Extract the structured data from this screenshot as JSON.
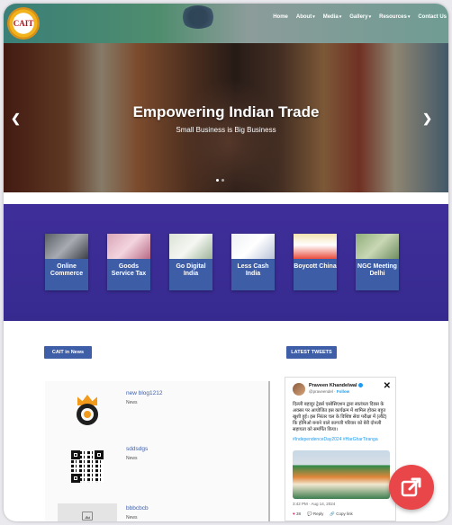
{
  "header": {
    "logo_text": "CAIT",
    "menu": [
      {
        "label": "Home",
        "has_caret": false
      },
      {
        "label": "About",
        "has_caret": true
      },
      {
        "label": "Media",
        "has_caret": true
      },
      {
        "label": "Gallery",
        "has_caret": true
      },
      {
        "label": "Resources",
        "has_caret": true
      },
      {
        "label": "Contact Us",
        "has_caret": false
      }
    ]
  },
  "hero": {
    "title": "Empowering Indian Trade",
    "subtitle": "Small Business is Big Business",
    "prev_icon": "chevron-left-icon",
    "next_icon": "chevron-right-icon",
    "slide_count": 2,
    "active_slide": 1
  },
  "features": {
    "cards": [
      {
        "label": "Online Commerce"
      },
      {
        "label": "Goods Service Tax"
      },
      {
        "label": "Go Digital India"
      },
      {
        "label": "Less Cash India"
      },
      {
        "label": "Boycott China"
      },
      {
        "label": "NGC Meeting Delhi"
      }
    ]
  },
  "news": {
    "tab_label": "CAIT in News",
    "items": [
      {
        "title": "new blog1212",
        "category": "News",
        "thumb": "crown-logo"
      },
      {
        "title": "sddsdgs",
        "category": "News",
        "thumb": "qr-code"
      },
      {
        "title": "bbbcbcb",
        "category": "News",
        "thumb": "image-placeholder-icon"
      }
    ]
  },
  "tweets": {
    "tab_label": "LATEST TWEETS",
    "tweet": {
      "author": "Praveen Khandelwal",
      "handle": "@praveendel",
      "follow": "Follow",
      "text": "दिल्ली बहादुर ट्रेडर्स एसोसिएशन द्वारा स्वतंत्रता दिवस के अवसर पर आयोजित इस कार्यक्रम में शामिल होकर बहुत खुशी हुई। इस निरंतर चल के विशिष्ट सेवा परीक्षा में (लौटे) कि होमिओ बनाने वाले कागजी परिवार को बेरी दोनली सहायता को समर्पित किया।",
      "hashtags": "#IndependenceDay2024 #HarGharTiranga",
      "time": "3:42 PM · Aug 14, 2024",
      "likes": "38",
      "reply": "Reply",
      "copy_link": "Copy link"
    }
  },
  "fab": {
    "icon": "share-arrow-icon"
  },
  "colors": {
    "primary_blue": "#3e5ea8",
    "purple_band": "#3f2e9a",
    "fab_red": "#e9464a"
  }
}
